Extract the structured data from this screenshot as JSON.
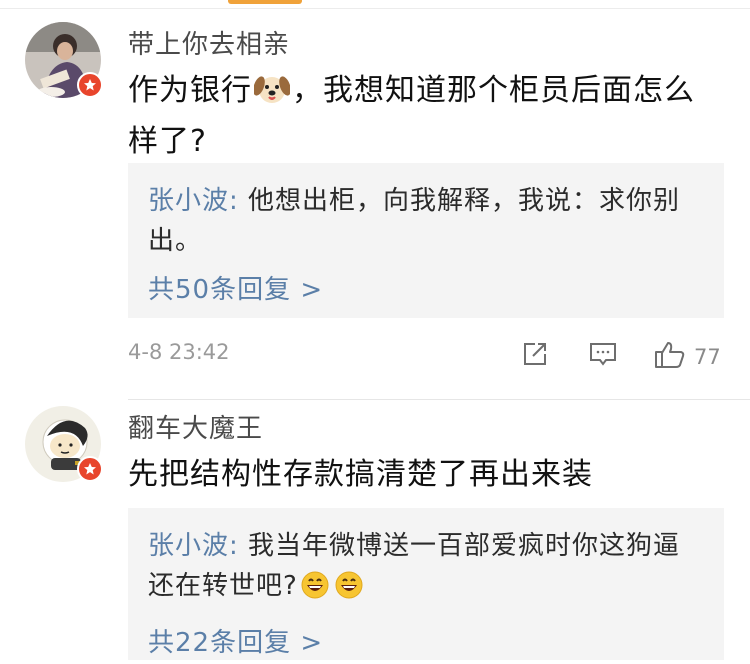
{
  "comments": [
    {
      "username": "带上你去相亲",
      "text_before_emoji": "作为银行",
      "emoji": "dog-face-emoji",
      "text_after_emoji": "，我想知道那个柜员后面怎么样了?",
      "reply": {
        "user": "张小波",
        "separator": ": ",
        "text": "他想出柜，向我解释，我说：求你别出。",
        "more": "共50条回复 >"
      },
      "timestamp": "4-8 23:42",
      "likes": "77",
      "icons": [
        "share-icon",
        "comment-icon",
        "like-icon"
      ]
    },
    {
      "username": "翻车大魔王",
      "text": "先把结构性存款搞清楚了再出来装",
      "reply": {
        "user": "张小波",
        "separator": ": ",
        "text": "我当年微博送一百部爱疯时你这狗逼还在转世吧?",
        "emojis": [
          "grinning-face-emoji",
          "grinning-face-emoji"
        ],
        "more": "共22条回复 >"
      }
    }
  ],
  "colors": {
    "accent": "#f0a23a",
    "link": "#5b7fa8",
    "verified_badge": "#e8452c"
  }
}
